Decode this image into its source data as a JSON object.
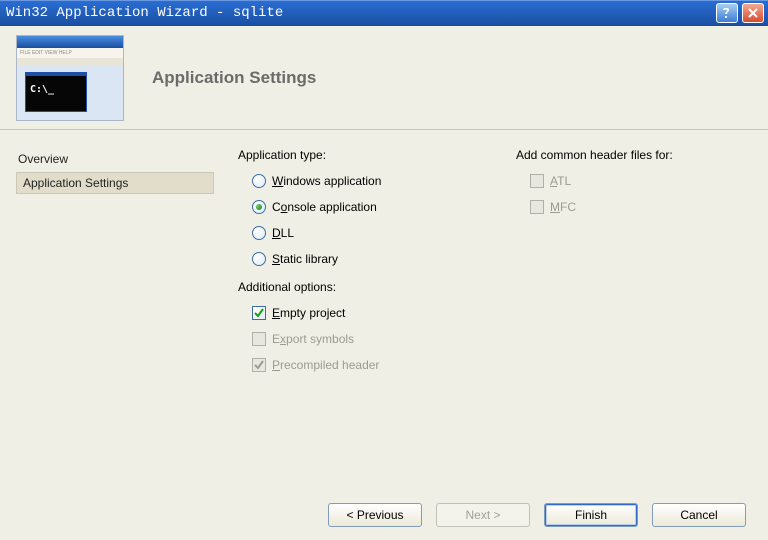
{
  "window": {
    "title": "Win32 Application Wizard - sqlite"
  },
  "header": {
    "title": "Application Settings"
  },
  "nav": {
    "items": [
      {
        "label": "Overview",
        "selected": false
      },
      {
        "label": "Application Settings",
        "selected": true
      }
    ]
  },
  "groups": {
    "app_type": {
      "label": "Application type:",
      "options": [
        {
          "label_html": "<u>W</u>indows application"
        },
        {
          "label_html": "C<u>o</u>nsole application"
        },
        {
          "label_html": "<u>D</u>LL"
        },
        {
          "label_html": "<u>S</u>tatic library"
        }
      ],
      "selected_index": 1
    },
    "additional": {
      "label": "Additional options:",
      "options": [
        {
          "label_html": "<u>E</u>mpty project",
          "checked": true,
          "disabled": false
        },
        {
          "label_html": "E<u>x</u>port symbols",
          "checked": false,
          "disabled": true
        },
        {
          "label_html": "<u>P</u>recompiled header",
          "checked": true,
          "disabled": true
        }
      ]
    },
    "headers": {
      "label": "Add common header files for:",
      "options": [
        {
          "label_html": "<u>A</u>TL",
          "checked": false,
          "disabled": true
        },
        {
          "label_html": "<u>M</u>FC",
          "checked": false,
          "disabled": true
        }
      ]
    }
  },
  "footer": {
    "previous": "< Previous",
    "next": "Next >",
    "finish": "Finish",
    "cancel": "Cancel"
  }
}
